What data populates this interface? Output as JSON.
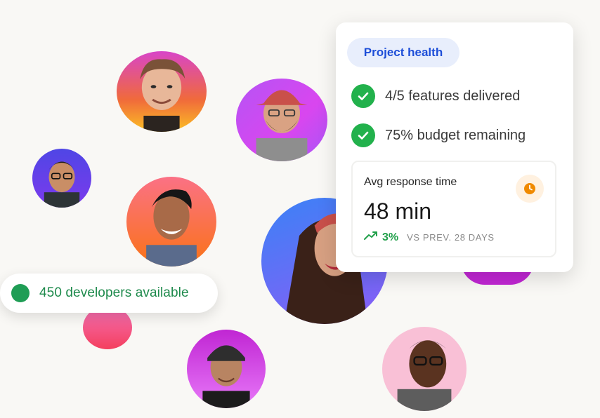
{
  "developers_pill": {
    "text": "450 developers available",
    "dot_color": "#1f9d55"
  },
  "health_card": {
    "badge": "Project health",
    "checks": [
      {
        "label": "4/5 features delivered",
        "icon": "check-icon"
      },
      {
        "label": "75% budget remaining",
        "icon": "check-icon"
      }
    ],
    "response": {
      "label": "Avg response time",
      "value": "48 min",
      "trend_value": "3%",
      "trend_caption": "VS PREV. 28 DAYS",
      "icon": "clock-icon",
      "trend_icon": "trend-up-icon"
    }
  },
  "colors": {
    "accent_blue": "#1d4ed8",
    "success_green": "#22b14c",
    "clock_orange": "#f08a00"
  }
}
